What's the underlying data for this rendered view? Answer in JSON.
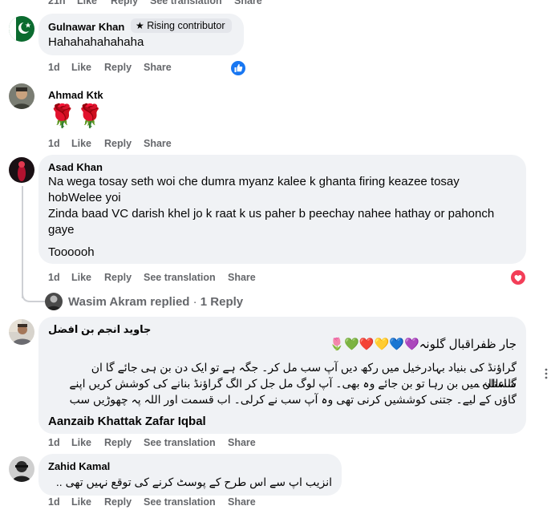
{
  "top_partial": {
    "time": "21h",
    "like": "Like",
    "reply": "Reply",
    "see_translation": "See translation",
    "share": "Share"
  },
  "comments": [
    {
      "author": "Gulnawar Khan",
      "badge": "Rising contributor",
      "lines": [
        "Hahahahahahaha"
      ],
      "actions": {
        "time": "1d",
        "like": "Like",
        "reply": "Reply",
        "share": "Share"
      },
      "reaction": "like-reaction-icon"
    },
    {
      "author": "Ahmad Ktk",
      "emoji": "🌹🌹",
      "actions": {
        "time": "1d",
        "like": "Like",
        "reply": "Reply",
        "share": "Share"
      }
    },
    {
      "author": "Asad Khan",
      "lines": [
        "Na wega tosay seth woi che dumra myanz kalee k ghanta firing keazee tosay",
        "hobWelee yoi",
        "Zinda baad VC darish khel jo k raat k us paher b peechay nahee hathay or pahonch",
        "gaye",
        "Toooooh"
      ],
      "actions": {
        "time": "1d",
        "like": "Like",
        "reply": "Reply",
        "see_translation": "See translation",
        "share": "Share"
      },
      "reaction": "love-reaction-icon"
    },
    {
      "author": "جاوید انجم بن افضل",
      "lines": [
        "جار ظفراقبال گلونہ💜💙💛❤️💚🌷",
        "گراؤنڈ کی بنیاد بہادرخیل میں رکھ دیں آپ سب مل کر۔ جگہ ہے تو ایک دن بن ہی جائے گا ان شاءاللہ۔",
        "گلستان میں بن رہا تو بن جائے وہ بھی۔ آپ لوگ مل جل کر الگ گراؤنڈ بنانے کی کوشش کریں اپنے",
        "گاؤں کے لیے۔ جتنی کوششیں کرنی تھی وہ آپ سب نے کرلی۔ اب قسمت اور اللہ پہ چھوڑیں سب"
      ],
      "mentions": "Aanzaib Khattak Zafar Iqbal",
      "actions": {
        "time": "1d",
        "like": "Like",
        "reply": "Reply",
        "see_translation": "See translation",
        "share": "Share"
      }
    },
    {
      "author": "Zahid Kamal",
      "lines": [
        "انزیب اپ سے اس طرح کے پوسٹ کرنے کی توقع نہیں تھی .."
      ],
      "actions": {
        "time": "1d",
        "like": "Like",
        "reply": "Reply",
        "see_translation": "See translation",
        "share": "Share"
      }
    }
  ],
  "replies_link": {
    "name": "Wasim Akram",
    "text": "replied",
    "sep": "·",
    "count": "1 Reply"
  },
  "colors": {
    "bubble": "#f0f2f5",
    "secondary_text": "#65676b",
    "like_blue": "#1877f2",
    "love_red": "#f33e58"
  }
}
